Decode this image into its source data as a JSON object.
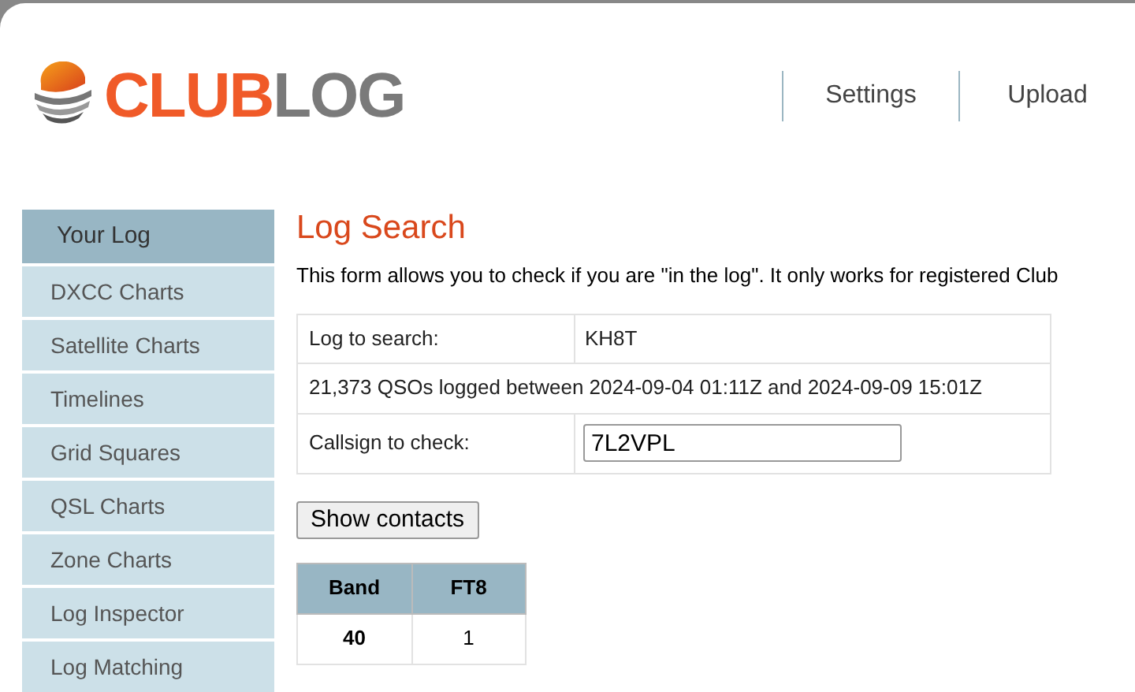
{
  "logo": {
    "part_1": "CLUB",
    "part_2": "LOG"
  },
  "nav": [
    "Settings",
    "Upload"
  ],
  "sidebar": {
    "items": [
      {
        "label": "Your Log",
        "selected": true
      },
      {
        "label": "DXCC Charts",
        "selected": false
      },
      {
        "label": "Satellite Charts",
        "selected": false
      },
      {
        "label": "Timelines",
        "selected": false
      },
      {
        "label": "Grid Squares",
        "selected": false
      },
      {
        "label": "QSL Charts",
        "selected": false
      },
      {
        "label": "Zone Charts",
        "selected": false
      },
      {
        "label": "Log Inspector",
        "selected": false
      },
      {
        "label": "Log Matching",
        "selected": false
      }
    ]
  },
  "title": "Log Search",
  "intro": "This form allows you to check if you are \"in the log\". It only works for registered Club",
  "form": {
    "log_label": "Log to search:",
    "log_value": "KH8T",
    "summary": "21,373 QSOs logged between 2024-09-04 01:11Z and 2024-09-09 15:01Z",
    "callsign_label": "Callsign to check:",
    "callsign_value": "7L2VPL"
  },
  "button": "Show contacts",
  "results": {
    "columns": [
      "Band",
      "FT8"
    ],
    "rows": [
      [
        "40",
        "1"
      ]
    ]
  }
}
